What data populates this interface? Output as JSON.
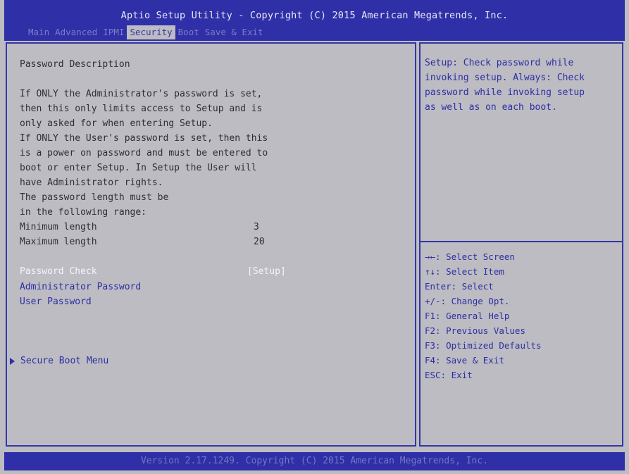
{
  "header": {
    "title": "Aptio Setup Utility - Copyright (C) 2015 American Megatrends, Inc.",
    "tabs": [
      {
        "label": "Main"
      },
      {
        "label": "Advanced"
      },
      {
        "label": "IPMI"
      },
      {
        "label": "Security",
        "active": true
      },
      {
        "label": "Boot"
      },
      {
        "label": "Save & Exit"
      }
    ]
  },
  "left": {
    "description_title": "Password Description",
    "description_lines": [
      "If ONLY the Administrator's password is set,",
      "then this only limits access to Setup and is",
      "only asked for when entering Setup.",
      "If ONLY the User's password is set, then this",
      "is a power on password and must be entered to",
      "boot or enter Setup. In Setup the User will",
      "have Administrator rights.",
      "The password length must be",
      "in the following range:"
    ],
    "min_length_label": "Minimum length",
    "min_length_value": "3",
    "max_length_label": "Maximum length",
    "max_length_value": "20",
    "items": {
      "password_check_label": "Password Check",
      "password_check_value": "[Setup]",
      "admin_password_label": "Administrator Password",
      "user_password_label": "User Password",
      "secure_boot_label": "Secure Boot Menu"
    }
  },
  "right": {
    "help_lines": [
      "Setup: Check password while",
      "invoking setup. Always: Check",
      "password while invoking setup",
      "as well as on each boot."
    ],
    "keys": [
      "→←: Select Screen",
      "↑↓: Select Item",
      "Enter: Select",
      "+/-: Change Opt.",
      "F1: General Help",
      "F2: Previous Values",
      "F3: Optimized Defaults",
      "F4: Save & Exit",
      "ESC: Exit"
    ]
  },
  "footer": {
    "version": "Version 2.17.1249. Copyright (C) 2015 American Megatrends, Inc."
  },
  "colors": {
    "header_blue": "#2f2fa8",
    "panel_gray": "#bcbcc2",
    "item_blue": "#2e2ea4",
    "selected_white": "#f4f4fa"
  }
}
